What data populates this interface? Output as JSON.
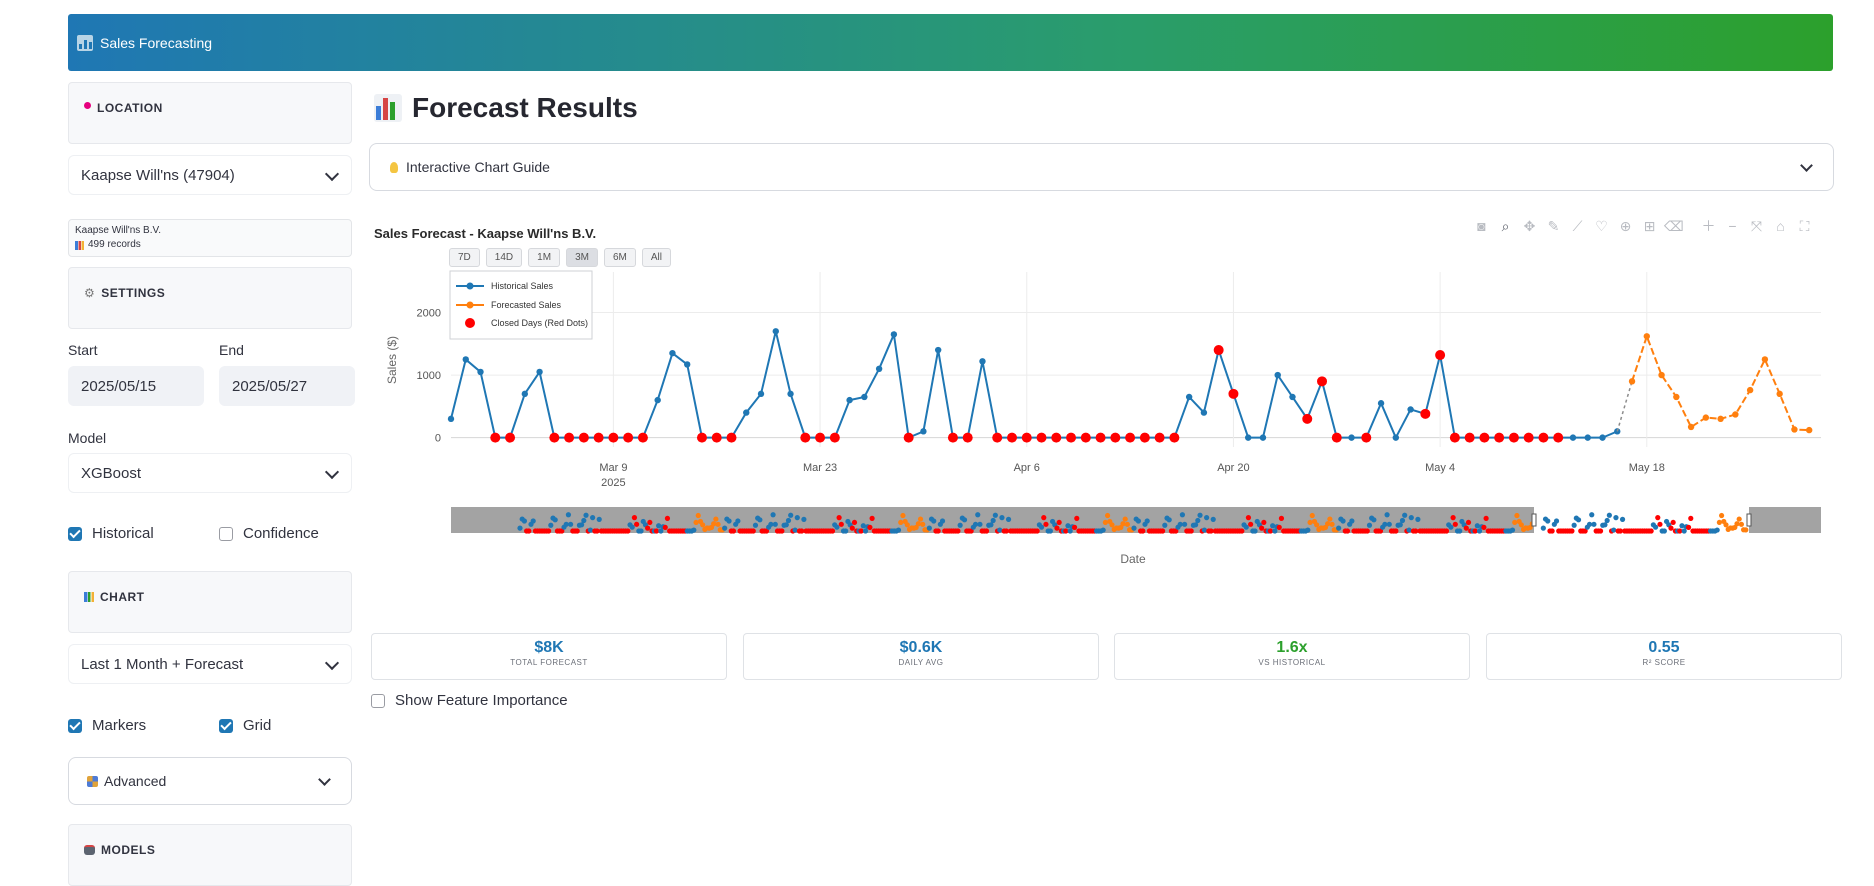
{
  "header": {
    "title": "Sales Forecasting",
    "icon": "bar-chart-icon"
  },
  "sidebar": {
    "location": {
      "heading": "LOCATION",
      "icon": "pin-icon",
      "selected": "Kaapse Will'ns (47904)"
    },
    "info": {
      "company": "Kaapse Will'ns B.V.",
      "records": "499 records"
    },
    "settings": {
      "heading": "SETTINGS",
      "icon": "gear-icon",
      "start_label": "Start",
      "start_value": "2025/05/15",
      "end_label": "End",
      "end_value": "2025/05/27",
      "model_label": "Model",
      "model_value": "XGBoost",
      "historical_label": "Historical",
      "historical_checked": true,
      "confidence_label": "Confidence",
      "confidence_checked": false
    },
    "chart": {
      "heading": "CHART",
      "icon": "bar-chart-icon",
      "range_value": "Last 1 Month + Forecast",
      "markers_label": "Markers",
      "markers_checked": true,
      "grid_label": "Grid",
      "grid_checked": true
    },
    "advanced": {
      "label": "Advanced",
      "icon": "grid-icon"
    },
    "models": {
      "heading": "MODELS",
      "icon": "robot-icon"
    }
  },
  "main": {
    "title": "Forecast Results",
    "guide": {
      "label": "Interactive Chart Guide",
      "icon": "lightbulb-icon"
    },
    "range_buttons": [
      "7D",
      "14D",
      "1M",
      "3M",
      "6M",
      "All"
    ],
    "range_active": "3M",
    "modebar": [
      "camera-icon",
      "zoom-icon",
      "pan-icon",
      "lasso-icon",
      "select-icon",
      "heart-icon",
      "plus-circle-icon",
      "box-icon",
      "erase-icon",
      "zoom-in-icon",
      "zoom-out-icon",
      "autoscale-icon",
      "home-icon",
      "fullscreen-icon"
    ],
    "metrics": [
      {
        "value": "$8K",
        "label": "TOTAL FORECAST",
        "color": "#1f77b4"
      },
      {
        "value": "$0.6K",
        "label": "DAILY AVG",
        "color": "#1f77b4"
      },
      {
        "value": "1.6x",
        "label": "VS HISTORICAL",
        "color": "#2ca02c"
      },
      {
        "value": "0.55",
        "label": "R² SCORE",
        "color": "#1f77b4"
      }
    ],
    "feature_importance": {
      "label": "Show Feature Importance",
      "checked": false
    }
  },
  "chart_data": {
    "type": "line",
    "title": "Sales Forecast - Kaapse Will'ns B.V.",
    "xlabel": "Date",
    "ylabel": "Sales ($)",
    "x_start": "2025-02-26",
    "x_ticks": [
      {
        "label": "Mar 9",
        "sub": "2025",
        "date": "2025-03-09"
      },
      {
        "label": "Mar 23",
        "sub": "",
        "date": "2025-03-23"
      },
      {
        "label": "Apr 6",
        "sub": "",
        "date": "2025-04-06"
      },
      {
        "label": "Apr 20",
        "sub": "",
        "date": "2025-04-20"
      },
      {
        "label": "May 4",
        "sub": "",
        "date": "2025-05-04"
      },
      {
        "label": "May 18",
        "sub": "",
        "date": "2025-05-18"
      }
    ],
    "y_ticks": [
      0,
      1000,
      2000
    ],
    "ylim": [
      -150,
      2200
    ],
    "grid": true,
    "legend": {
      "placement": "top-left",
      "entries": [
        "Historical Sales",
        "Forecasted Sales",
        "Closed Days (Red Dots)"
      ]
    },
    "colors": {
      "historical": "#1f77b4",
      "forecast": "#ff7f0e",
      "closed": "#ff0000"
    },
    "historical": [
      300,
      1250,
      1050,
      0,
      0,
      700,
      1050,
      0,
      0,
      0,
      0,
      0,
      0,
      0,
      600,
      1350,
      1170,
      0,
      0,
      0,
      400,
      700,
      1700,
      700,
      0,
      0,
      0,
      600,
      650,
      1100,
      1650,
      0,
      100,
      1400,
      0,
      0,
      1220,
      0,
      0,
      0,
      0,
      0,
      0,
      0,
      0,
      0,
      0,
      0,
      0,
      0,
      650,
      400,
      1400,
      700,
      0,
      0,
      1000,
      650,
      300,
      900,
      0,
      0,
      0,
      550,
      0,
      450,
      380,
      1320,
      0,
      0,
      0,
      0,
      0,
      0,
      0,
      0,
      0,
      0,
      0,
      100
    ],
    "closed_days": [
      3,
      4,
      7,
      8,
      9,
      10,
      11,
      12,
      13,
      17,
      18,
      19,
      24,
      25,
      26,
      31,
      34,
      35,
      37,
      38,
      39,
      40,
      41,
      42,
      43,
      44,
      45,
      46,
      47,
      48,
      49,
      52,
      53,
      58,
      59,
      60,
      62,
      66,
      67,
      68,
      69,
      70,
      71,
      72,
      73,
      74,
      75
    ],
    "forecast": [
      900,
      1620,
      1000,
      650,
      170,
      320,
      300,
      370,
      760,
      1250,
      700,
      130,
      120
    ]
  }
}
